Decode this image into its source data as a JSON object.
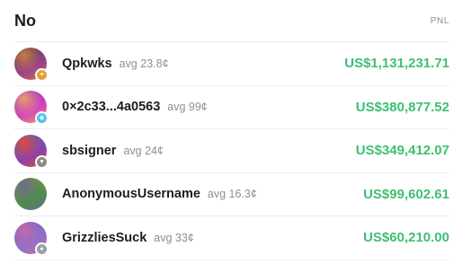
{
  "header": {
    "title": "No",
    "pnl_label": "PNL"
  },
  "colors": {
    "pnl_positive": "#3fbf73",
    "muted": "#8a8f98",
    "divider": "#ededf0"
  },
  "rows": [
    {
      "name": "Qpkwks",
      "avg": "avg 23.8¢",
      "pnl": "US$1,131,231.71",
      "avatar": [
        "#4a3b36",
        "#9a3f8f",
        "#c77a4a"
      ],
      "badge_icon": "gold-badge-icon",
      "badge_color": "#e0a13a",
      "badge_glyph": "✦"
    },
    {
      "name": "0×2c33...4a0563",
      "avg": "avg 99¢",
      "pnl": "US$380,877.52",
      "avatar": [
        "#7a2fd6",
        "#d445b8",
        "#f19a6c"
      ],
      "badge_icon": "diamond-badge-icon",
      "badge_color": "#4fc3f7",
      "badge_glyph": "◆"
    },
    {
      "name": "sbsigner",
      "avg": "avg 24¢",
      "pnl": "US$349,412.07",
      "avatar": [
        "#2f7ad1",
        "#8b3fae",
        "#e0483d"
      ],
      "badge_icon": "shield-badge-icon",
      "badge_color": "#8d8a80",
      "badge_glyph": "▼"
    },
    {
      "name": "AnonymousUsername",
      "avg": "avg 16.3¢",
      "pnl": "US$99,602.61",
      "avatar": [
        "#8d9a3a",
        "#4c8d4a",
        "#6b6a8c"
      ],
      "badge_icon": null,
      "badge_color": null,
      "badge_glyph": null
    },
    {
      "name": "GrizzliesSuck",
      "avg": "avg 33¢",
      "pnl": "US$60,210.00",
      "avatar": [
        "#6a5fd1",
        "#8f6fc8",
        "#c96aa6"
      ],
      "badge_icon": "silver-badge-icon",
      "badge_color": "#9aa0ab",
      "badge_glyph": "●"
    }
  ]
}
